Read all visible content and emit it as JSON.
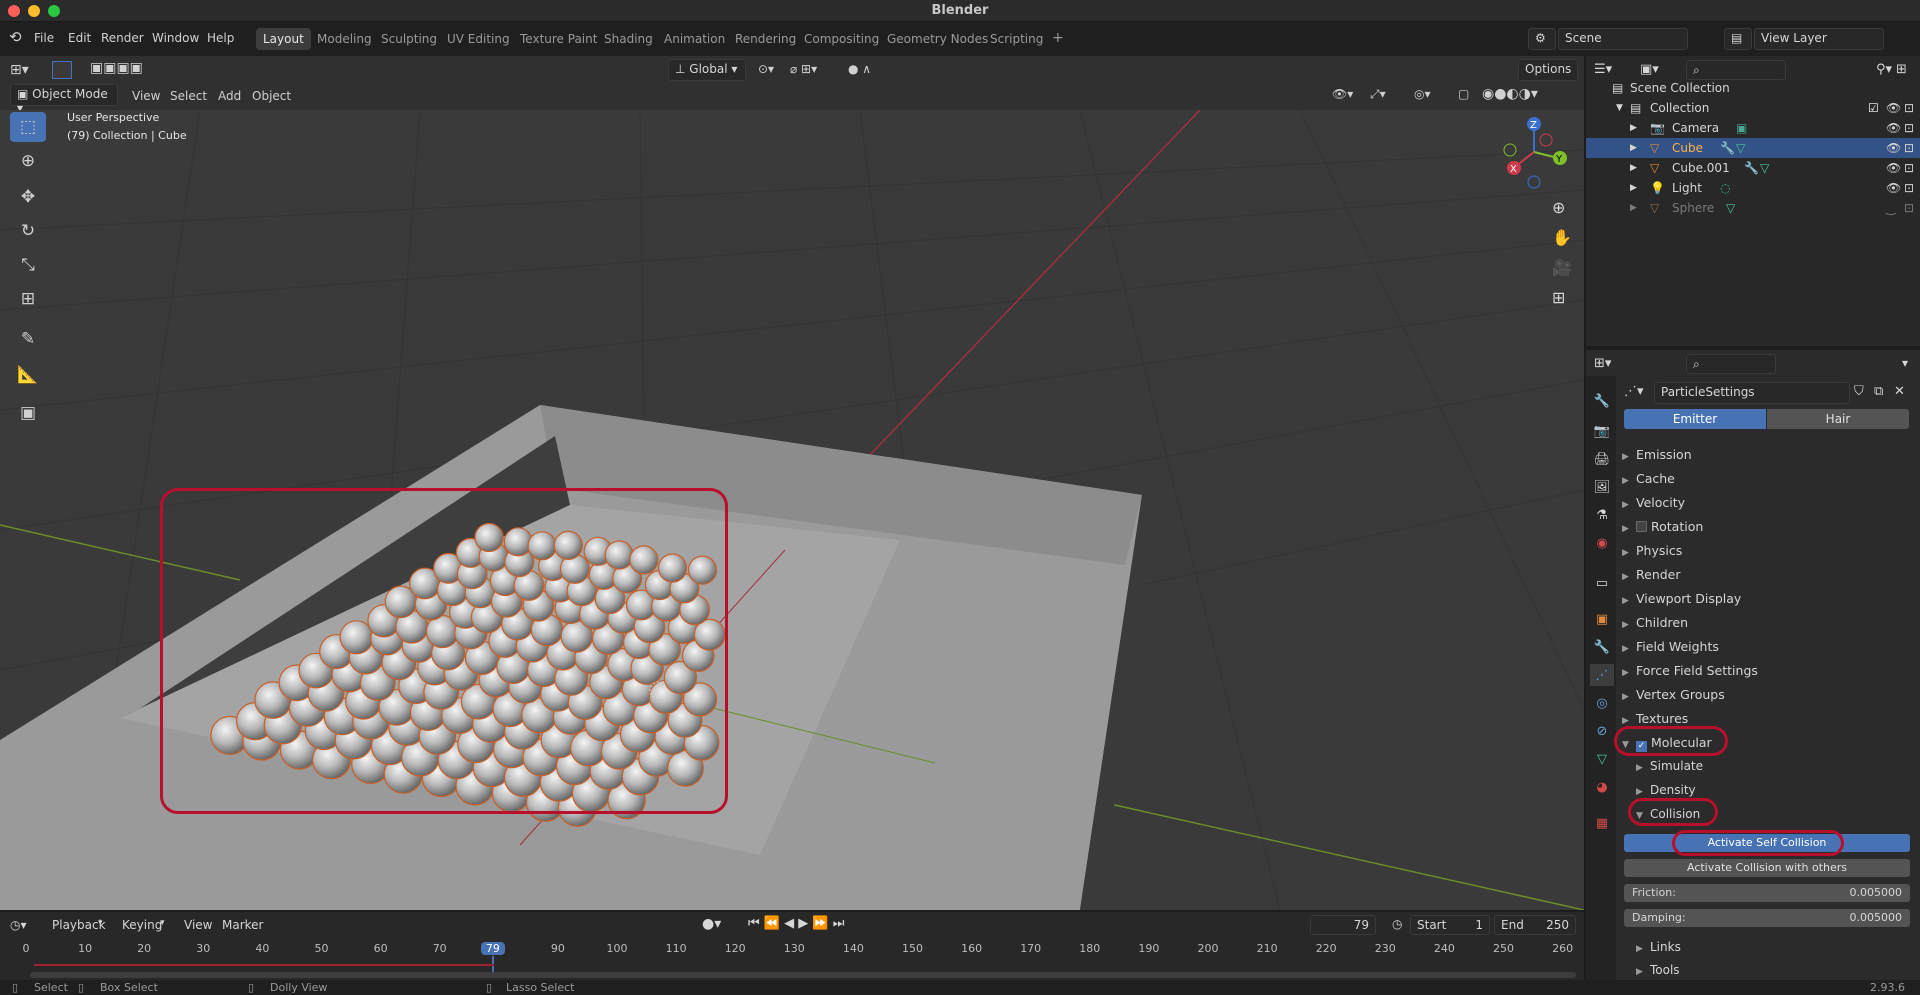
{
  "window": {
    "title": "Blender"
  },
  "menus": [
    "File",
    "Edit",
    "Render",
    "Window",
    "Help"
  ],
  "workspaces": [
    "Layout",
    "Modeling",
    "Sculpting",
    "UV Editing",
    "Texture Paint",
    "Shading",
    "Animation",
    "Rendering",
    "Compositing",
    "Geometry Nodes",
    "Scripting"
  ],
  "scene": {
    "name": "Scene",
    "view_layer": "View Layer"
  },
  "viewport": {
    "mode": "Object Mode",
    "menus": [
      "View",
      "Select",
      "Add",
      "Object"
    ],
    "orientation": "Global",
    "options_label": "Options",
    "overlay_title": "User Perspective",
    "overlay_sub": "(79) Collection | Cube",
    "gizmo": {
      "z": "Z",
      "y": "Y",
      "x": "X"
    }
  },
  "outliner": {
    "root": "Scene Collection",
    "collection": "Collection",
    "items": [
      {
        "name": "Camera"
      },
      {
        "name": "Cube",
        "selected": true
      },
      {
        "name": "Cube.001"
      },
      {
        "name": "Light"
      },
      {
        "name": "Sphere"
      }
    ]
  },
  "properties": {
    "datablock": "ParticleSettings",
    "tabs": [
      "Emitter",
      "Hair"
    ],
    "panels": [
      "Emission",
      "Cache",
      "Velocity",
      "Rotation",
      "Physics",
      "Render",
      "Viewport Display",
      "Children",
      "Field Weights",
      "Force Field Settings",
      "Vertex Groups",
      "Textures",
      "Molecular"
    ],
    "molecular_subpanels": [
      "Simulate",
      "Density",
      "Collision"
    ],
    "collision": {
      "self_collision_button": "Activate Self Collision",
      "others_button": "Activate Collision with others",
      "friction_label": "Friction:",
      "friction_value": "0.005000",
      "damping_label": "Damping:",
      "damping_value": "0.005000"
    },
    "more_subpanels": [
      "Links",
      "Tools"
    ]
  },
  "timeline": {
    "menus": [
      "Playback",
      "Keying",
      "View",
      "Marker"
    ],
    "current_frame": "79",
    "start_label": "Start",
    "start_value": "1",
    "end_label": "End",
    "end_value": "250",
    "ticks": [
      "0",
      "10",
      "20",
      "30",
      "40",
      "50",
      "60",
      "70",
      "79",
      "90",
      "100",
      "110",
      "120",
      "130",
      "140",
      "150",
      "160",
      "170",
      "180",
      "190",
      "200",
      "210",
      "220",
      "230",
      "240",
      "250",
      "260"
    ]
  },
  "statusbar": {
    "select": "Select",
    "box_select": "Box Select",
    "dolly": "Dolly View",
    "lasso": "Lasso Select",
    "version": "2.93.6"
  },
  "colors": {
    "accent": "#4772b3",
    "highlight": "#b8102c",
    "selected_row": "#335285"
  }
}
